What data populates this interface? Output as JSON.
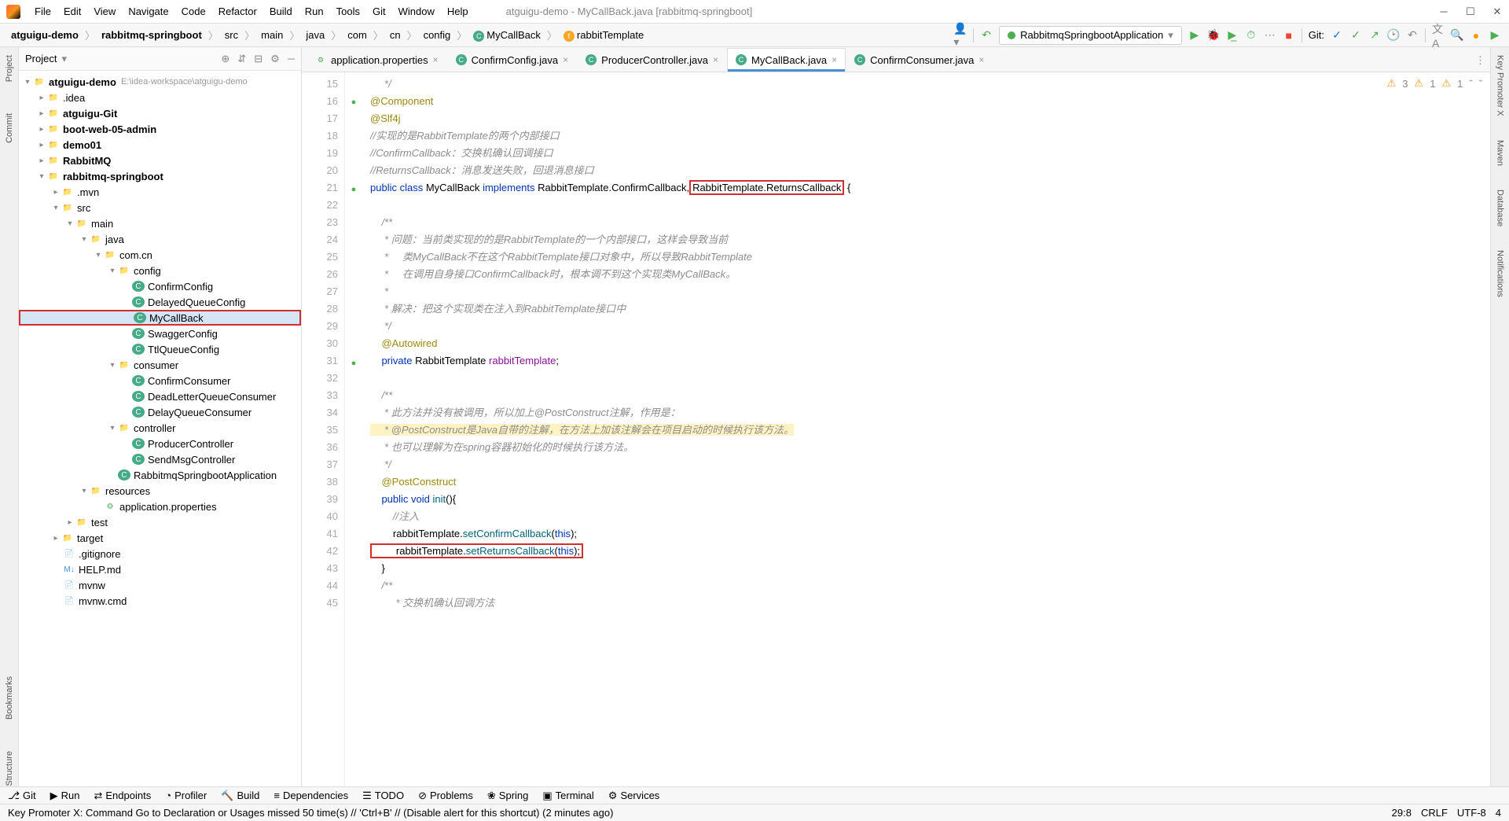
{
  "window_title": "atguigu-demo - MyCallBack.java [rabbitmq-springboot]",
  "menu": {
    "file": "File",
    "edit": "Edit",
    "view": "View",
    "navigate": "Navigate",
    "code": "Code",
    "refactor": "Refactor",
    "build": "Build",
    "run": "Run",
    "tools": "Tools",
    "git": "Git",
    "window": "Window",
    "help": "Help"
  },
  "breadcrumb": {
    "p1": "atguigu-demo",
    "p2": "rabbitmq-springboot",
    "p3": "src",
    "p4": "main",
    "p5": "java",
    "p6": "com",
    "p7": "cn",
    "p8": "config",
    "p9": "MyCallBack",
    "p10": "rabbitTemplate"
  },
  "runconfig": "RabbitmqSpringbootApplication",
  "git_label": "Git:",
  "project": {
    "title": "Project"
  },
  "tree": {
    "root": "atguigu-demo",
    "root_hint": "E:\\idea-workspace\\atguigu-demo",
    "idea": ".idea",
    "git": "atguigu-Git",
    "boot": "boot-web-05-admin",
    "demo01": "demo01",
    "rabbitmq": "RabbitMQ",
    "rabbitmqsb": "rabbitmq-springboot",
    "mvn": ".mvn",
    "src": "src",
    "main": "main",
    "java": "java",
    "comcn": "com.cn",
    "config": "config",
    "confirmconfig": "ConfirmConfig",
    "delayed": "DelayedQueueConfig",
    "mycallback": "MyCallBack",
    "swagger": "SwaggerConfig",
    "ttl": "TtlQueueConfig",
    "consumer": "consumer",
    "confirmconsumer": "ConfirmConsumer",
    "deadletter": "DeadLetterQueueConsumer",
    "delayconsumer": "DelayQueueConsumer",
    "controller": "controller",
    "producer": "ProducerController",
    "sendmsg": "SendMsgController",
    "app": "RabbitmqSpringbootApplication",
    "resources": "resources",
    "appprops": "application.properties",
    "test": "test",
    "target": "target",
    "gitignore": ".gitignore",
    "help": "HELP.md",
    "mvnw": "mvnw",
    "mvnwcmd": "mvnw.cmd"
  },
  "tabs": {
    "t1": "application.properties",
    "t2": "ConfirmConfig.java",
    "t3": "ProducerController.java",
    "t4": "MyCallBack.java",
    "t5": "ConfirmConsumer.java"
  },
  "code": {
    "l15": "     */",
    "l16a": "@Component",
    "l17a": "@Slf4j",
    "l18": "//实现的是RabbitTemplate的两个内部接口",
    "l19": "//ConfirmCallback：交换机确认回调接口",
    "l20": "//ReturnsCallback：消息发送失败，回退消息接口",
    "l21_pub": "public ",
    "l21_cls": "class ",
    "l21_name": "MyCallBack ",
    "l21_impl": "implements ",
    "l21_rt1": "RabbitTemplate.ConfirmCallback,",
    "l21_rt2": "RabbitTemplate.ReturnsCallback",
    "l21_brace": " {",
    "l23": "    /**",
    "l24": "     * 问题：当前类实现的的是RabbitTemplate的一个内部接口，这样会导致当前",
    "l25": "     *     类MyCallBack不在这个RabbitTemplate接口对象中，所以导致RabbitTemplate",
    "l26": "     *     在调用自身接口ConfirmCallback时，根本调不到这个实现类MyCallBack。",
    "l27": "     *",
    "l28": "     * 解决：把这个实现类在注入到RabbitTemplate接口中",
    "l29": "     */",
    "l30": "    @Autowired",
    "l31_priv": "    private ",
    "l31_type": "RabbitTemplate ",
    "l31_fld": "rabbitTemplate",
    "l31_semi": ";",
    "l33": "    /**",
    "l34": "     * 此方法并没有被调用，所以加上@PostConstruct注解，作用是：",
    "l35": "     * @PostConstruct是Java自带的注解，在方法上加该注解会在项目启动的时候执行该方法。",
    "l36": "     * 也可以理解为在spring容器初始化的时候执行该方法。",
    "l37": "     */",
    "l38": "    @PostConstruct",
    "l39_pub": "    public ",
    "l39_void": "void ",
    "l39_name": "init",
    "l39_p": "(){",
    "l40": "        //注入",
    "l41_a": "        rabbitTemplate.",
    "l41_m": "setConfirmCallback",
    "l41_p": "(",
    "l41_this": "this",
    "l41_e": ");",
    "l42_a": "        rabbitTemplate.",
    "l42_m": "setReturnsCallback",
    "l42_p": "(",
    "l42_this": "this",
    "l42_e": ");",
    "l43": "    }",
    "l44": "    /**",
    "l45": "         * 交换机确认回调方法"
  },
  "side": {
    "project": "Project",
    "commit": "Commit",
    "bookmarks": "Bookmarks",
    "structure": "Structure",
    "keypromoter": "Key Promoter X",
    "maven": "Maven",
    "database": "Database",
    "notifications": "Notifications"
  },
  "bottom": {
    "git": "Git",
    "run": "Run",
    "endpoints": "Endpoints",
    "profiler": "Profiler",
    "build": "Build",
    "dependencies": "Dependencies",
    "todo": "TODO",
    "problems": "Problems",
    "spring": "Spring",
    "terminal": "Terminal",
    "services": "Services"
  },
  "status": {
    "msg": "Key Promoter X: Command Go to Declaration or Usages missed 50 time(s) // 'Ctrl+B' // (Disable alert for this shortcut) (2 minutes ago)",
    "pos": "29:8",
    "crlf": "CRLF",
    "enc": "UTF-8",
    "spaces": "4"
  },
  "inspect": {
    "w1": "3",
    "w2": "1",
    "w3": "1"
  }
}
